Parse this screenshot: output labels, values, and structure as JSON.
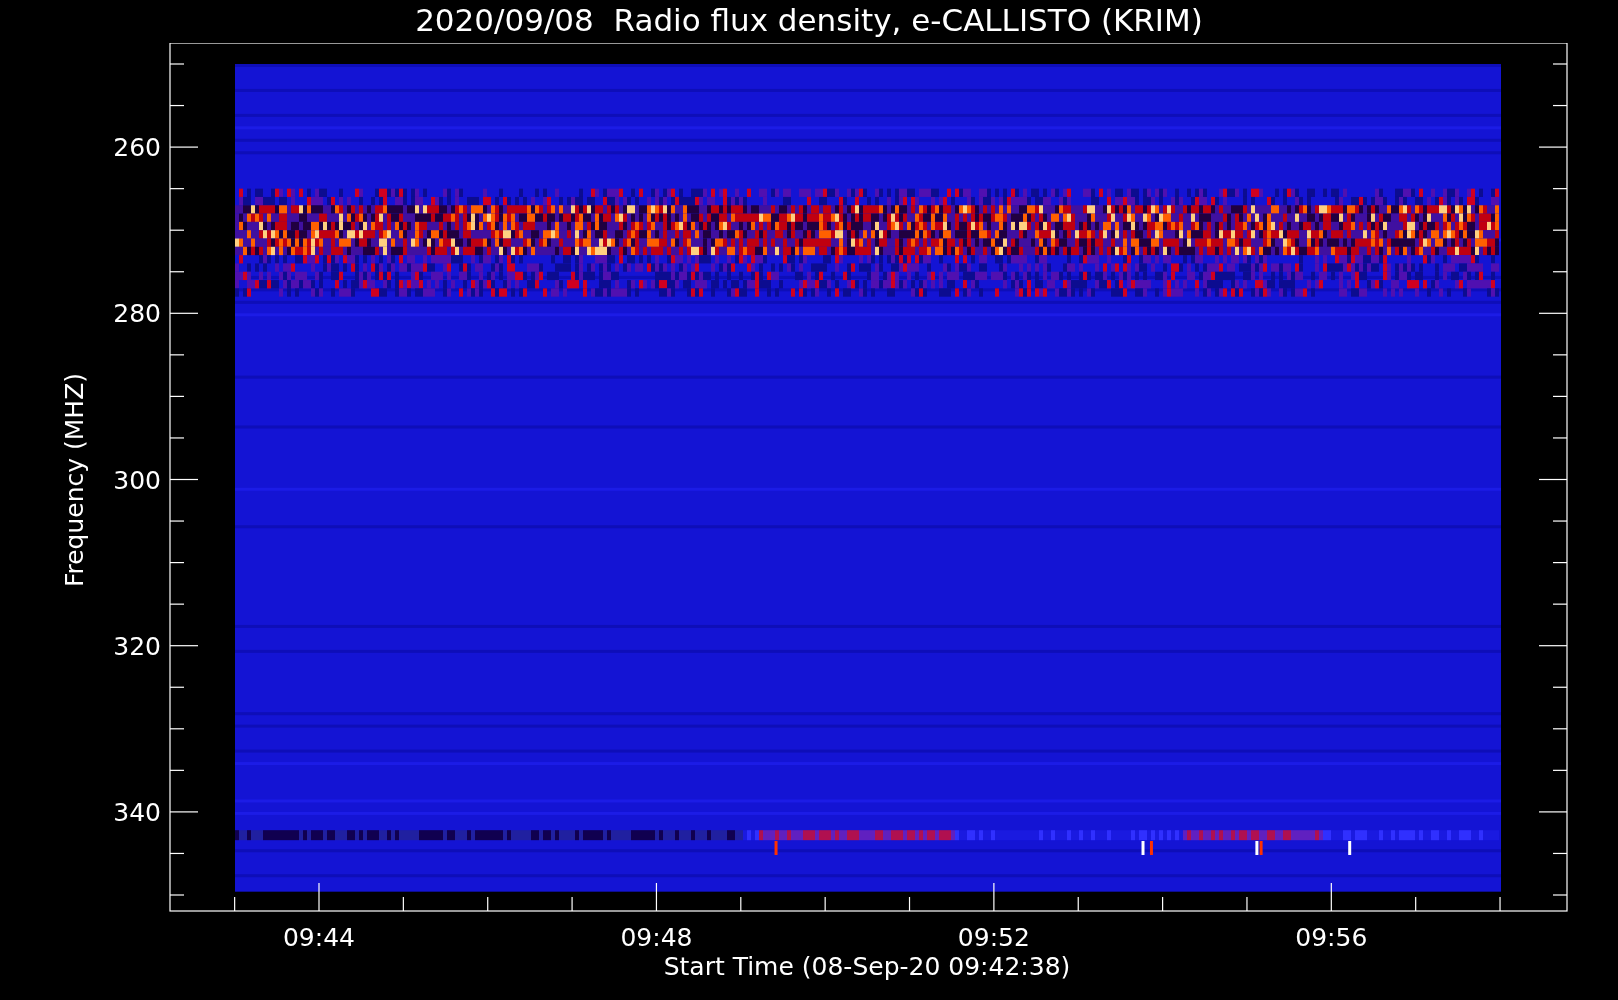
{
  "plot": {
    "title": "2020/09/08  Radio flux density, e-CALLISTO (KRIM)",
    "xlabel": "Start Time (08-Sep-20 09:42:38)",
    "ylabel": "Frequency (MHZ)",
    "xticks": [
      "09:44",
      "09:48",
      "09:52",
      "09:56"
    ],
    "yticks": [
      "260",
      "280",
      "300",
      "320",
      "340"
    ]
  }
}
